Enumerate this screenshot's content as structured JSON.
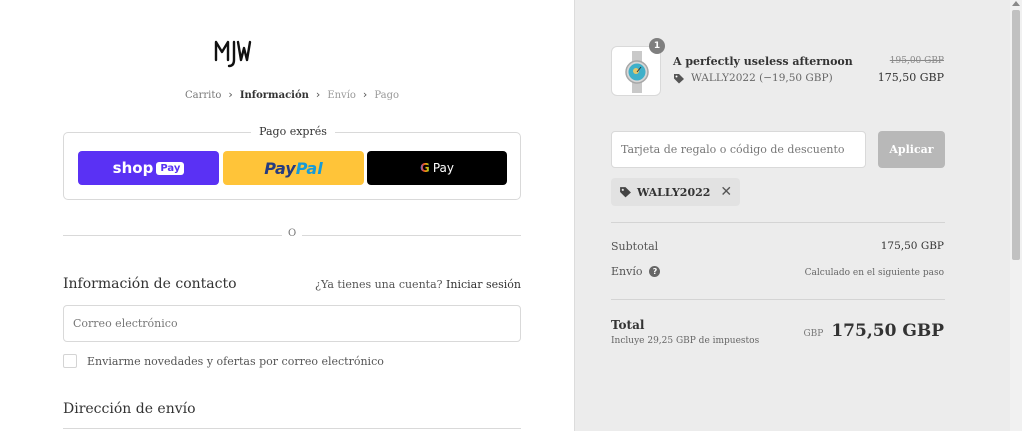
{
  "brand": {
    "logo_text": "MJW"
  },
  "breadcrumb": {
    "items": [
      {
        "label": "Carrito"
      },
      {
        "label": "Información"
      },
      {
        "label": "Envío"
      },
      {
        "label": "Pago"
      }
    ]
  },
  "express_checkout": {
    "title": "Pago exprés",
    "shop_pay": {
      "label": "shop",
      "pill": "Pay"
    },
    "paypal": {
      "part1": "Pay",
      "part2": "Pal"
    },
    "gpay": {
      "g": "G",
      "label": "Pay"
    }
  },
  "separator": {
    "label": "O"
  },
  "contact": {
    "title": "Información de contacto",
    "has_account": "¿Ya tienes una cuenta?",
    "login_link": "Iniciar sesión",
    "email_placeholder": "Correo electrónico",
    "newsletter_label": "Enviarme novedades y ofertas por correo electrónico"
  },
  "shipping": {
    "title": "Dirección de envío"
  },
  "order": {
    "product": {
      "quantity": "1",
      "name": "A perfectly useless afternoon",
      "discount": "WALLY2022 (−19,50 GBP)",
      "original_price": "195,00 GBP",
      "price": "175,50 GBP"
    },
    "discount_input_placeholder": "Tarjeta de regalo o código de descuento",
    "apply_label": "Aplicar",
    "applied_code": "WALLY2022",
    "subtotal_label": "Subtotal",
    "subtotal_value": "175,50 GBP",
    "shipping_label": "Envío",
    "shipping_value": "Calculado en el siguiente paso",
    "total_label": "Total",
    "tax_note": "Incluye 29,25 GBP de impuestos",
    "total_currency": "GBP",
    "total_value": "175,50 GBP"
  },
  "colors": {
    "shop_pay": "#5a31f4",
    "paypal": "#ffc439",
    "gpay": "#000000",
    "summary_bg": "#ececec"
  }
}
